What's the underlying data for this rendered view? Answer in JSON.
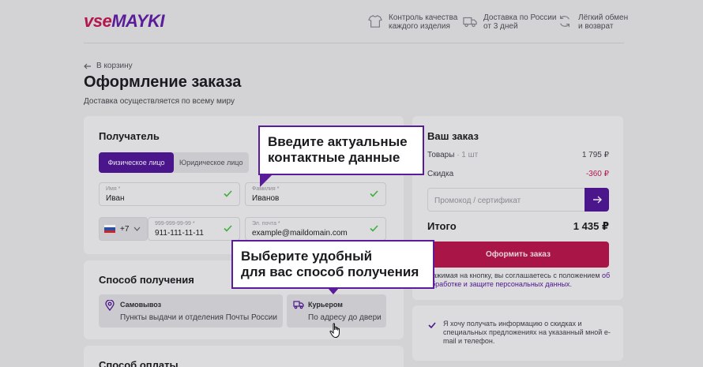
{
  "header": {
    "logo_part1": "vse",
    "logo_part2": "MAYKI",
    "features": [
      {
        "icon": "tshirt-icon",
        "line1": "Контроль качества",
        "line2": "каждого изделия"
      },
      {
        "icon": "truck-icon",
        "line1": "Доставка по России",
        "line2": "от 3 дней"
      },
      {
        "icon": "refresh-icon",
        "line1": "Лёгкий обмен",
        "line2": "и возврат"
      }
    ]
  },
  "nav": {
    "back_label": "В корзину"
  },
  "page": {
    "title": "Оформление заказа",
    "subtitle": "Доставка осуществляется по всему миру"
  },
  "recipient": {
    "title": "Получатель",
    "tabs": [
      "Физическое лицо",
      "Юридическое лицо"
    ],
    "active_tab": "Физическое лицо",
    "name": {
      "label": "Имя *",
      "value": "Иван"
    },
    "surname": {
      "label": "Фамилия *",
      "value": "Иванов"
    },
    "country_code": "+7",
    "phone": {
      "label": "999-999-99-99 *",
      "value": "911-111-11-11"
    },
    "email": {
      "label": "Эл. почта *",
      "value": "example@maildomain.com"
    }
  },
  "delivery": {
    "title": "Способ получения",
    "options": [
      {
        "title": "Самовывоз",
        "desc": "Пункты выдачи и отделения Почты России"
      },
      {
        "title": "Курьером",
        "desc": "По адресу до двери"
      }
    ],
    "next_section_title": "Способ оплаты"
  },
  "order": {
    "title": "Ваш заказ",
    "goods_label": "Товары",
    "goods_qty": "· 1 шт",
    "goods_price": "1 795 ₽",
    "discount_label": "Скидка",
    "discount_value": "-360 ₽",
    "promo_placeholder": "Промокод / сертификат",
    "total_label": "Итого",
    "total_value": "1 435 ₽",
    "submit_label": "Оформить заказ",
    "terms_text": "Нажимая на кнопку, вы соглашаетесь с положением ",
    "terms_link": "об обработке и защите персональных данных",
    "terms_end": ".",
    "optin_text": "Я хочу получать информацию о скидках и специальных предложениях на указанный мной e-mail и телефон."
  },
  "tooltips": {
    "tip1_line1": "Введите актуальные",
    "tip1_line2": "контактные данные",
    "tip2_line1": "Выберите удобный",
    "tip2_line2": "для вас способ получения"
  },
  "colors": {
    "brand_red": "#b2174e",
    "brand_purple": "#4b168c",
    "check_green": "#3fae3a"
  }
}
